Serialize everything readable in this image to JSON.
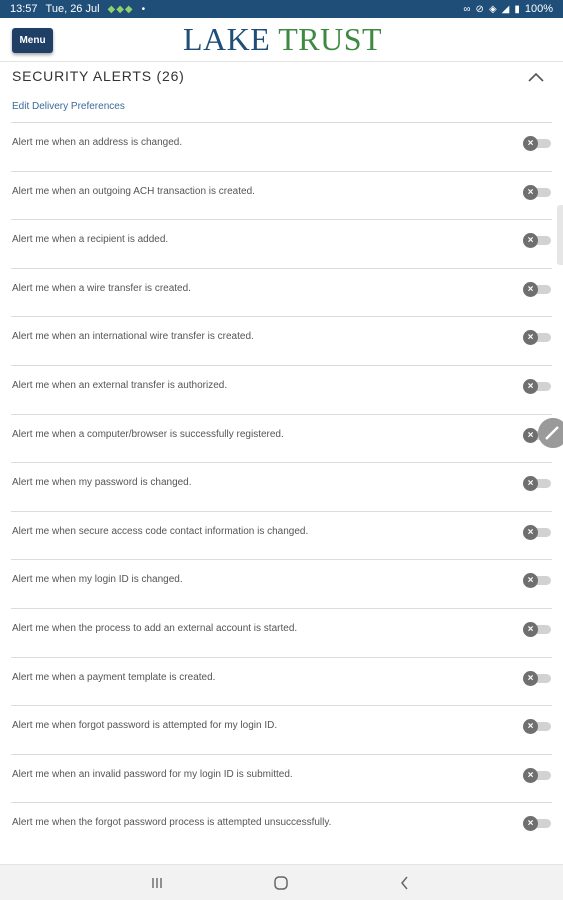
{
  "status_bar": {
    "time": "13:57",
    "date": "Tue, 26 Jul",
    "battery": "100%",
    "icons": [
      "leaf-icon",
      "leaf-icon",
      "leaf-icon",
      "dot-icon",
      "link-icon",
      "mute-icon",
      "wifi-icon",
      "signal-icon",
      "battery-icon"
    ]
  },
  "header": {
    "menu_label": "Menu",
    "logo_word1": "LAKE",
    "logo_word2": "TRUST"
  },
  "section": {
    "title": "SECURITY ALERTS (26)",
    "edit_link": "Edit Delivery Preferences"
  },
  "alerts": [
    {
      "label": "Alert me when an address is changed.",
      "enabled": false
    },
    {
      "label": "Alert me when an outgoing ACH transaction is created.",
      "enabled": false
    },
    {
      "label": "Alert me when a recipient is added.",
      "enabled": false
    },
    {
      "label": "Alert me when a wire transfer is created.",
      "enabled": false
    },
    {
      "label": "Alert me when an international wire transfer is created.",
      "enabled": false
    },
    {
      "label": "Alert me when an external transfer is authorized.",
      "enabled": false
    },
    {
      "label": "Alert me when a computer/browser is successfully registered.",
      "enabled": false
    },
    {
      "label": "Alert me when my password is changed.",
      "enabled": false
    },
    {
      "label": "Alert me when secure access code contact information is changed.",
      "enabled": false
    },
    {
      "label": "Alert me when my login ID is changed.",
      "enabled": false
    },
    {
      "label": "Alert me when the process to add an external account is started.",
      "enabled": false
    },
    {
      "label": "Alert me when a payment template is created.",
      "enabled": false
    },
    {
      "label": "Alert me when forgot password is attempted for my login ID.",
      "enabled": false
    },
    {
      "label": "Alert me when an invalid password for my login ID is submitted.",
      "enabled": false
    },
    {
      "label": "Alert me when the forgot password process is attempted unsuccessfully.",
      "enabled": false
    }
  ],
  "colors": {
    "status_bar": "#1f4e79",
    "menu_button": "#1f3f66",
    "logo_blue": "#1f4e79",
    "logo_green": "#3f8a43",
    "link": "#3a6a9a",
    "toggle_off_knob": "#6f6f6f",
    "toggle_off_track": "#d2d2d2"
  },
  "nav_bar": {
    "icons": [
      "recent-apps-icon",
      "home-icon",
      "back-icon"
    ]
  }
}
